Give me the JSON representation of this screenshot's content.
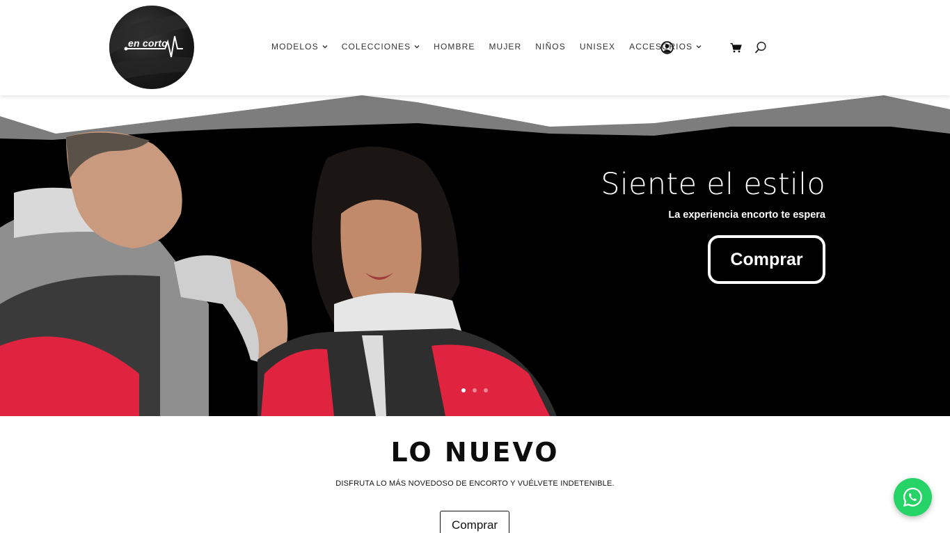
{
  "header": {
    "logo_text": "en corto",
    "nav": [
      {
        "label": "MODELOS",
        "has_dropdown": true
      },
      {
        "label": "COLECCIONES",
        "has_dropdown": true
      },
      {
        "label": "HOMBRE",
        "has_dropdown": false
      },
      {
        "label": "MUJER",
        "has_dropdown": false
      },
      {
        "label": "NIÑOS",
        "has_dropdown": false
      },
      {
        "label": "UNISEX",
        "has_dropdown": false
      },
      {
        "label": "ACCESORIOS",
        "has_dropdown": true
      }
    ],
    "icons": [
      "account-icon",
      "cart-icon",
      "search-icon"
    ]
  },
  "hero": {
    "title": "Siente el estilo",
    "subtitle": "La experiencia encorto te espera",
    "button_label": "Comprar",
    "slides_count": 3,
    "active_slide": 1
  },
  "section": {
    "title": "LO NUEVO",
    "subtitle": "DISFRUTA LO MÁS NOVEDOSO DE ENCORTO Y VUÉLVETE INDETENIBLE.",
    "button_label": "Comprar"
  },
  "floating": {
    "whatsapp_icon": "whatsapp-icon",
    "color": "#25d366"
  },
  "colors": {
    "accent_red": "#e0233f",
    "hero_bg": "#000000",
    "mountain_gray": "#7d7d7d"
  }
}
